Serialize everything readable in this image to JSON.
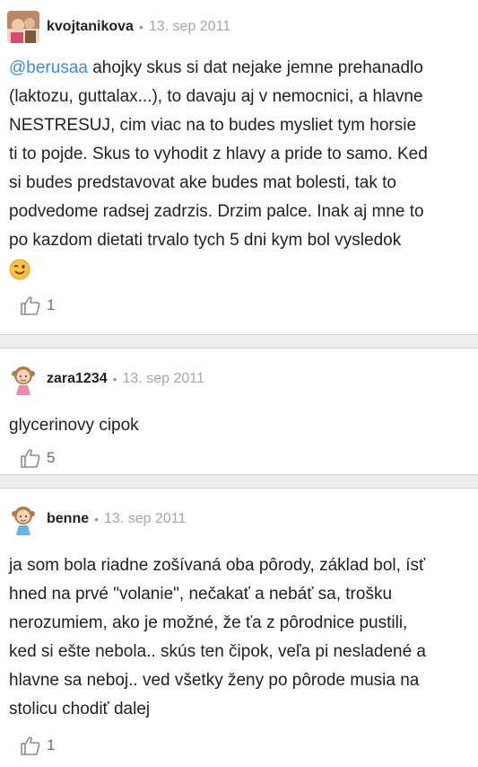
{
  "comments": [
    {
      "username": "kvojtanikova",
      "date": "13. sep 2011",
      "mention": "@berusaa",
      "text_lines": [
        " ahojky skus si dat nejake jemne prehanadlo",
        "(laktozu, guttalax...), to davaju aj v nemocnici, a hlavne",
        "NESTRESUJ, cim viac na to budes mysliet tym horsie",
        "ti to pojde. Skus to vyhodit z hlavy a pride to samo. Ked",
        "si budes predstavovat ake budes mat bolesti, tak to",
        "podvedome radsej zadrzis. Drzim palce. Inak aj mne to",
        "po kazdom dietati trvalo tych 5 dni kym bol vysledok"
      ],
      "emoji": "wink-emoji",
      "likes": "1",
      "avatar_icon": "photo-avatar"
    },
    {
      "username": "zara1234",
      "date": "13. sep 2011",
      "text_lines": [
        "glycerinovy cipok"
      ],
      "likes": "5",
      "avatar_icon": "girl-avatar"
    },
    {
      "username": "benne",
      "date": "13. sep 2011",
      "text_lines": [
        "ja som bola riadne zošívaná oba pôrody, základ bol, ísť",
        "hned na prvé \"volanie\", nečakať a nebáť sa, trošku",
        "nerozumiem, ako je možné, že ťa z pôrodnice pustili,",
        "ked si ešte nebola.. skús ten čipok, veľa pi nesladené a",
        "hlavne sa neboj.. ved všetky ženy po pôrode musia na",
        "stolicu chodiť dalej"
      ],
      "likes": "1",
      "avatar_icon": "girl-avatar"
    }
  ],
  "separator_char": "•",
  "colors": {
    "mention": "#3a8ee6",
    "separator_bg": "#eeeeee",
    "meta": "#a6a6a6"
  }
}
